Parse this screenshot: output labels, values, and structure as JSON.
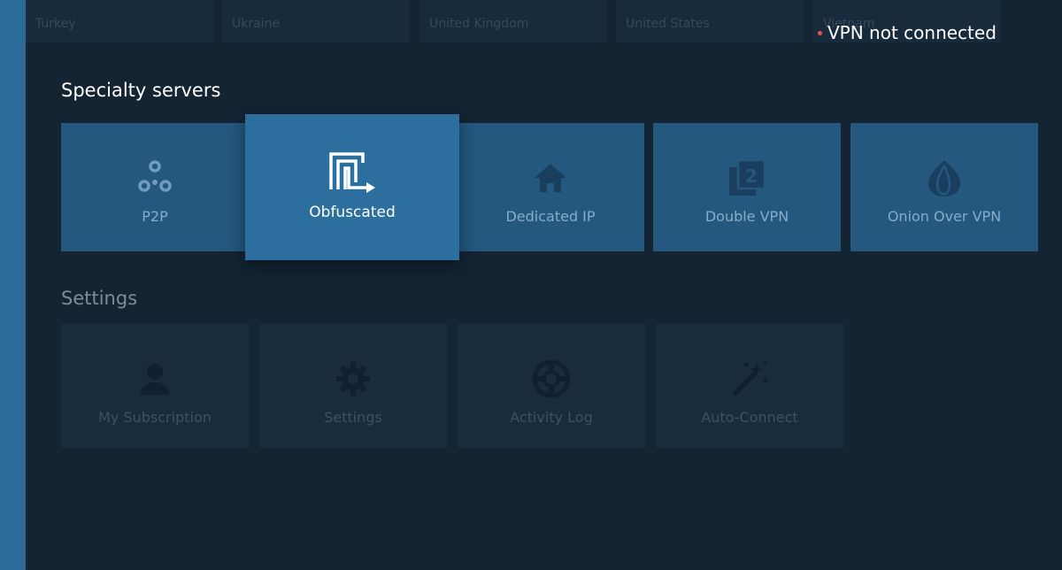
{
  "countries": [
    "Turkey",
    "Ukraine",
    "United Kingdom",
    "United States",
    "Vietnam"
  ],
  "status": {
    "text": "VPN not connected",
    "dot_color": "#e5534b"
  },
  "specialty": {
    "title": "Specialty servers",
    "items": [
      {
        "label": "P2P",
        "icon": "p2p-icon"
      },
      {
        "label": "Obfuscated",
        "icon": "obfuscated-icon",
        "focused": true
      },
      {
        "label": "Dedicated IP",
        "icon": "home-icon"
      },
      {
        "label": "Double VPN",
        "icon": "double-vpn-icon"
      },
      {
        "label": "Onion Over VPN",
        "icon": "onion-icon"
      }
    ]
  },
  "settings": {
    "title": "Settings",
    "items": [
      {
        "label": "My Subscription",
        "icon": "user-icon"
      },
      {
        "label": "Settings",
        "icon": "gear-icon"
      },
      {
        "label": "Activity Log",
        "icon": "lifebuoy-icon"
      },
      {
        "label": "Auto-Connect",
        "icon": "magic-wand-icon"
      }
    ]
  },
  "colors": {
    "accent": "#2c6e9e",
    "rail": "#2c6b98",
    "background": "#142433"
  }
}
